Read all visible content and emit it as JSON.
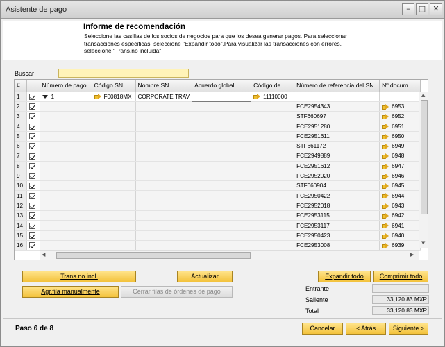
{
  "window": {
    "title": "Asistente de pago"
  },
  "header": {
    "title": "Informe de recomendación",
    "description": "Seleccione las casillas de los socios de negocios para que los desea generar pagos. Para seleccionar transacciones especificas, seleccione \"Expandir todo\".Para visualizar las transacciones con errores, seleccione \"Trans.no incluida\"."
  },
  "search": {
    "label": "Buscar",
    "value": ""
  },
  "grid": {
    "columns": [
      "#",
      "",
      "Número de pago",
      "Código SN",
      "Nombre SN",
      "Acuerdo global",
      "Código de l...",
      "Número de referencia del SN",
      "Nº docum..."
    ],
    "first_row": {
      "row": "1",
      "payment_number": "1",
      "bp_code": "F00818MX",
      "bp_name": "CORPORATE TRAV",
      "global_agreement": "",
      "account_code": "11110000"
    },
    "rows": [
      {
        "row": "2",
        "ref": "FCE2954343",
        "doc": "6953"
      },
      {
        "row": "3",
        "ref": "STF660697",
        "doc": "6952"
      },
      {
        "row": "4",
        "ref": "FCE2951280",
        "doc": "6951"
      },
      {
        "row": "5",
        "ref": "FCE2951611",
        "doc": "6950"
      },
      {
        "row": "6",
        "ref": "STF661172",
        "doc": "6949"
      },
      {
        "row": "7",
        "ref": "FCE2949889",
        "doc": "6948"
      },
      {
        "row": "8",
        "ref": "FCE2951612",
        "doc": "6947"
      },
      {
        "row": "9",
        "ref": "FCE2952020",
        "doc": "6946"
      },
      {
        "row": "10",
        "ref": "STF660904",
        "doc": "6945"
      },
      {
        "row": "11",
        "ref": "FCE2950422",
        "doc": "6944"
      },
      {
        "row": "12",
        "ref": "FCE2952018",
        "doc": "6943"
      },
      {
        "row": "13",
        "ref": "FCE2953115",
        "doc": "6942"
      },
      {
        "row": "14",
        "ref": "FCE2953117",
        "doc": "6941"
      },
      {
        "row": "15",
        "ref": "FCE2950423",
        "doc": "6940"
      },
      {
        "row": "16",
        "ref": "FCE2953008",
        "doc": "6939"
      }
    ]
  },
  "buttons": {
    "trans_no_incl": "Trans.no incl.",
    "actualizar": "Actualizar",
    "expandir_todo": "Expandir todo",
    "comprimir_todo": "Comprimir todo",
    "agr_fila": "Agr.fila manualmente",
    "cerrar_filas": "Cerrar filas de órdenes de pago",
    "cancelar": "Cancelar",
    "atras": "< Atrás",
    "siguiente": "Siguiente >"
  },
  "totals": {
    "entrante_label": "Entrante",
    "entrante_value": "",
    "saliente_label": "Saliente",
    "saliente_value": "33,120.83 MXP",
    "total_label": "Total",
    "total_value": "33,120.83 MXP"
  },
  "footer": {
    "step": "Paso 6 de 8"
  }
}
